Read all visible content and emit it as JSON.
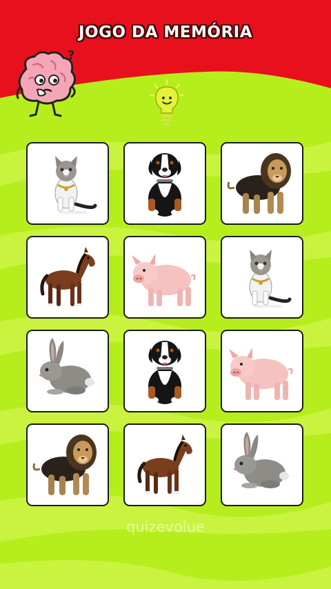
{
  "header": {
    "title": "JOGO DA MEMÓRIA",
    "mascot_icon": "brain-thinking-icon",
    "hint_icon": "lightbulb-icon"
  },
  "board": {
    "rows": 4,
    "columns": 3,
    "cards": [
      {
        "animal": "cat",
        "icon": "cat-icon"
      },
      {
        "animal": "dog",
        "icon": "dog-icon"
      },
      {
        "animal": "lion",
        "icon": "lion-icon"
      },
      {
        "animal": "horse",
        "icon": "horse-icon"
      },
      {
        "animal": "pig",
        "icon": "pig-icon"
      },
      {
        "animal": "cat",
        "icon": "cat-icon"
      },
      {
        "animal": "rabbit",
        "icon": "rabbit-icon"
      },
      {
        "animal": "dog",
        "icon": "dog-icon"
      },
      {
        "animal": "pig",
        "icon": "pig-icon"
      },
      {
        "animal": "lion",
        "icon": "lion-icon"
      },
      {
        "animal": "horse",
        "icon": "horse-icon"
      },
      {
        "animal": "rabbit",
        "icon": "rabbit-icon"
      }
    ]
  },
  "watermark": "quizevolue",
  "colors": {
    "header_red": "#e8101c",
    "field_green": "#b5ee1c",
    "stripe_green": "#ccf53e",
    "card_border": "#1a1a1a",
    "bulb_yellow": "#e4f23a"
  }
}
